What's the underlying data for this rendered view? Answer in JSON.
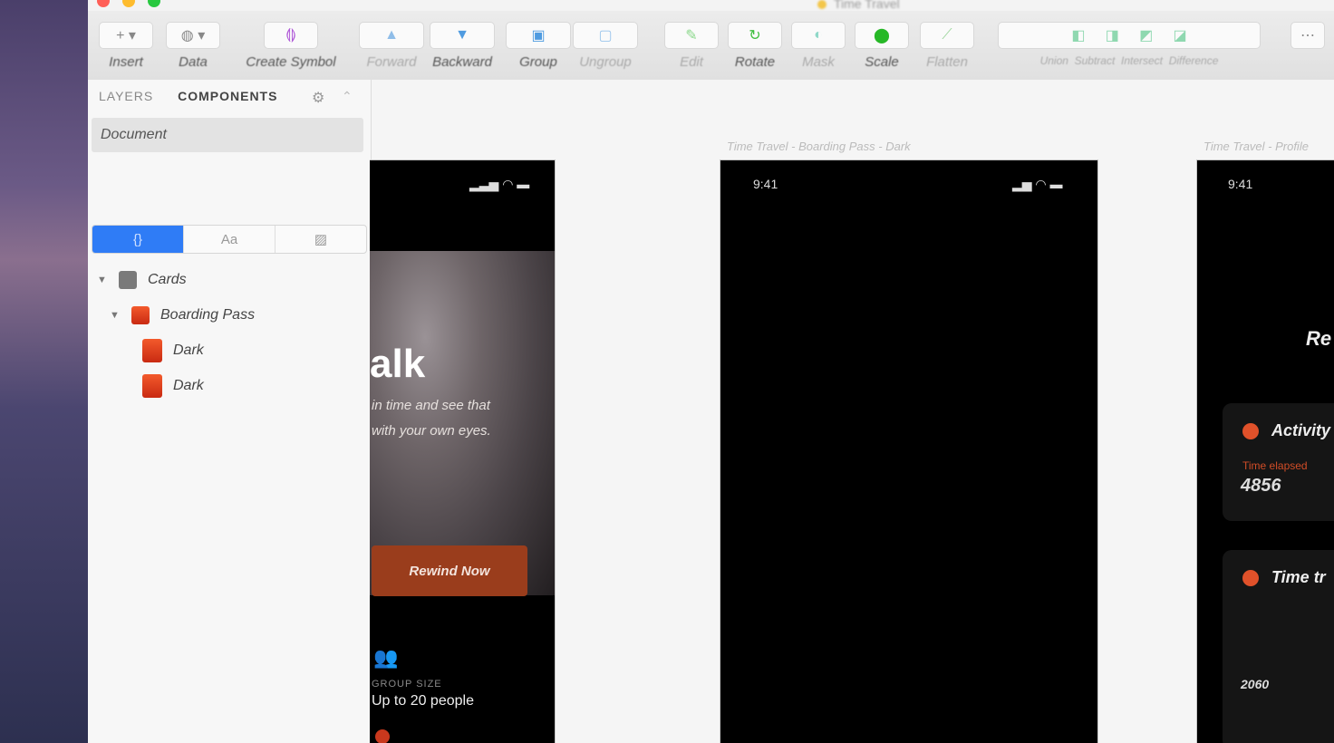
{
  "window": {
    "title": "Time Travel"
  },
  "toolbar": {
    "items": [
      {
        "label": "Insert",
        "icon": "plus-icon"
      },
      {
        "label": "Data",
        "icon": "database-icon"
      },
      {
        "label": "Create Symbol",
        "icon": "symbol-icon"
      },
      {
        "label": "Forward",
        "icon": "forward-icon"
      },
      {
        "label": "Backward",
        "icon": "backward-icon"
      },
      {
        "label": "Group",
        "icon": "group-icon"
      },
      {
        "label": "Ungroup",
        "icon": "ungroup-icon"
      },
      {
        "label": "Edit",
        "icon": "edit-icon"
      },
      {
        "label": "Rotate",
        "icon": "rotate-icon"
      },
      {
        "label": "Mask",
        "icon": "mask-icon"
      },
      {
        "label": "Scale",
        "icon": "scale-icon"
      },
      {
        "label": "Flatten",
        "icon": "flatten-icon"
      },
      {
        "label": "Union",
        "icon": "union-icon"
      },
      {
        "label": "Subtract",
        "icon": "subtract-icon"
      },
      {
        "label": "Intersect",
        "icon": "intersect-icon"
      },
      {
        "label": "Difference",
        "icon": "difference-icon"
      }
    ]
  },
  "sidebar": {
    "tab_layers": "LAYERS",
    "tab_components": "COMPONENTS",
    "document_label": "Document",
    "seg_symbols": "{}",
    "seg_text": "Aa",
    "seg_styles": "▨",
    "tree": [
      {
        "label": "Cards",
        "level": 0
      },
      {
        "label": "Boarding Pass",
        "level": 1
      },
      {
        "label": "Dark",
        "level": 2
      },
      {
        "label": "Dark",
        "level": 2
      }
    ]
  },
  "canvas": {
    "artboard2_label": "Time Travel - Boarding Pass - Dark",
    "artboard3_label": "Time Travel - Profile",
    "time": "9:41",
    "hero_title": "alk",
    "hero_line1": "in time and see that",
    "hero_line2": "with your own eyes.",
    "cta_label": "Rewind Now",
    "group_size_label": "GROUP SIZE",
    "group_size_value": "Up to 20 people",
    "profile_title": "Re",
    "card1_title": "Activity",
    "card1_small": "Time elapsed",
    "card1_value": "4856",
    "card2_title": "Time tr",
    "card2_value": "2060"
  }
}
